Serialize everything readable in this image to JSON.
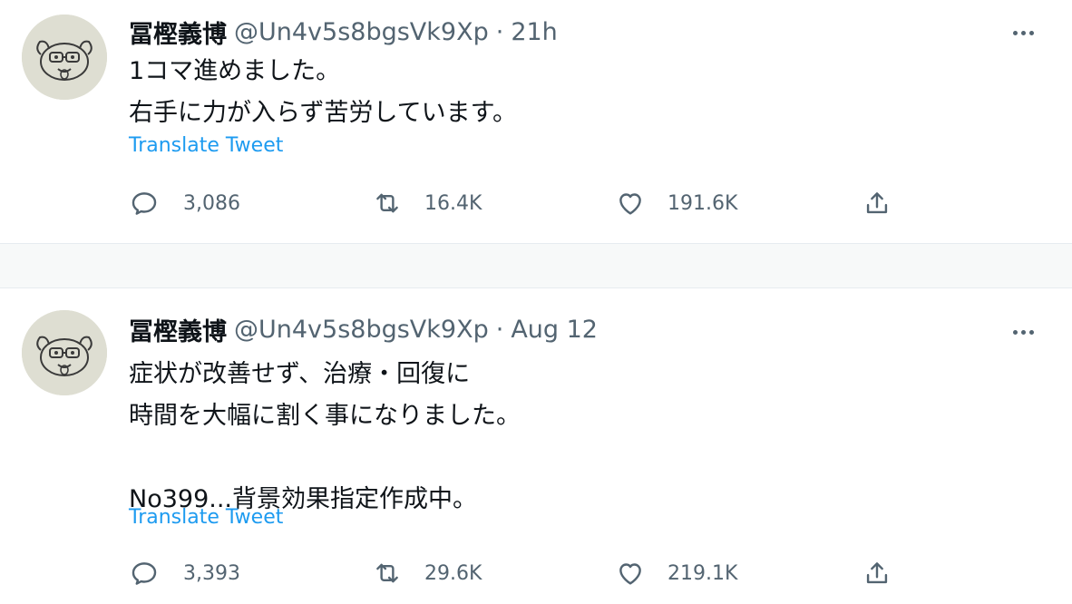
{
  "colors": {
    "text_primary": "#0f1419",
    "text_secondary": "#536471",
    "link": "#1d9bf0",
    "divider": "#e6ecf0"
  },
  "tweets": [
    {
      "author_name": "冨樫義博",
      "handle": "@Un4v5s8bgsVk9Xp",
      "separator": "·",
      "time": "21h",
      "text": "1コマ進めました。\n右手に力が入らず苦労しています。",
      "translate_label": "Translate Tweet",
      "replies": "3,086",
      "retweets": "16.4K",
      "likes": "191.6K",
      "icons": [
        "avatar-image",
        "more-icon",
        "reply-icon",
        "retweet-icon",
        "like-icon",
        "share-icon"
      ]
    },
    {
      "author_name": "冨樫義博",
      "handle": "@Un4v5s8bgsVk9Xp",
      "separator": "·",
      "time": "Aug 12",
      "text": "症状が改善せず、治療・回復に\n時間を大幅に割く事になりました。\n\nNo399...背景効果指定作成中。",
      "translate_label": "Translate Tweet",
      "replies": "3,393",
      "retweets": "29.6K",
      "likes": "219.1K",
      "icons": [
        "avatar-image",
        "more-icon",
        "reply-icon",
        "retweet-icon",
        "like-icon",
        "share-icon"
      ]
    }
  ]
}
